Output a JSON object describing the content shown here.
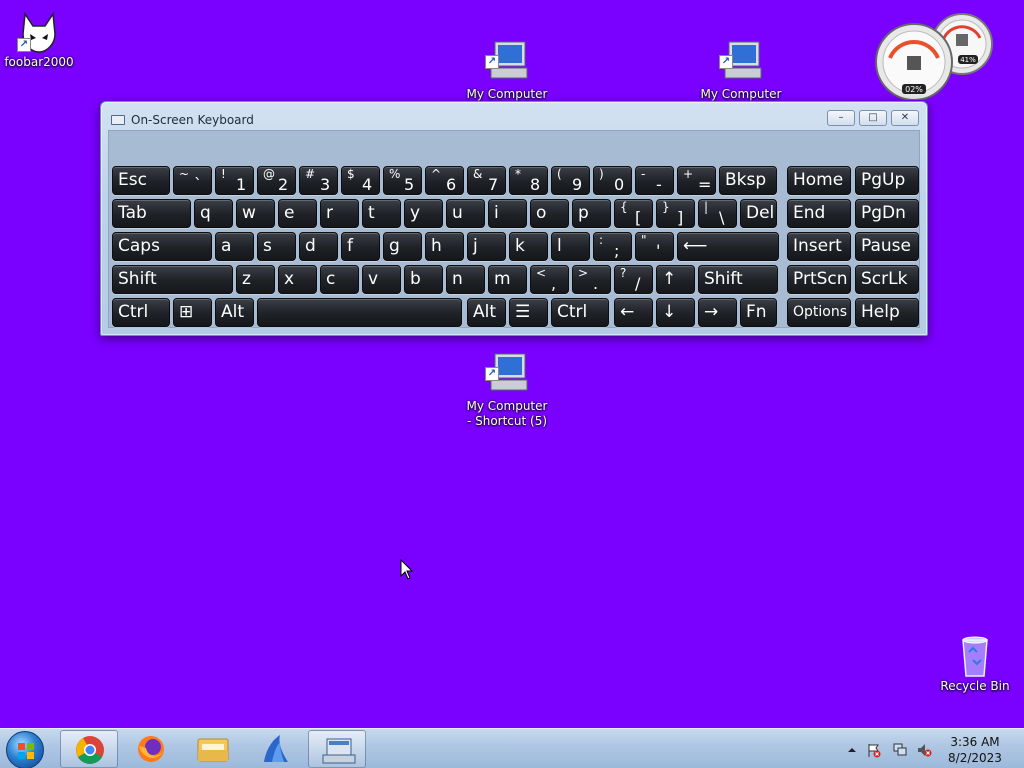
{
  "desktop": {
    "icons": {
      "foobar": {
        "label": "foobar2000"
      },
      "mc4": {
        "label": "My Computer\n- Shortcut (4)"
      },
      "mc2": {
        "label": "My Computer\n- Shortcut (2)"
      },
      "mc5": {
        "label": "My Computer\n- Shortcut (5)"
      },
      "recycle": {
        "label": "Recycle Bin"
      }
    },
    "gadget": {
      "cpu": "02%",
      "mem": "41%"
    }
  },
  "osk": {
    "title": "On-Screen Keyboard",
    "controls": {
      "minimize": "–",
      "restore": "□",
      "close": "✕"
    },
    "rows": [
      [
        {
          "main": "Esc"
        },
        {
          "up": "~",
          "low": "`"
        },
        {
          "up": "!",
          "low": "1"
        },
        {
          "up": "@",
          "low": "2"
        },
        {
          "up": "#",
          "low": "3"
        },
        {
          "up": "$",
          "low": "4"
        },
        {
          "up": "%",
          "low": "5"
        },
        {
          "up": "^",
          "low": "6"
        },
        {
          "up": "&",
          "low": "7"
        },
        {
          "up": "*",
          "low": "8"
        },
        {
          "up": "(",
          "low": "9"
        },
        {
          "up": ")",
          "low": "0"
        },
        {
          "up": "-",
          "low": "-"
        },
        {
          "up": "+",
          "low": "="
        },
        {
          "main": "Bksp"
        },
        {
          "main": "Home"
        },
        {
          "main": "PgUp"
        }
      ],
      [
        {
          "main": "Tab"
        },
        {
          "main": "q"
        },
        {
          "main": "w"
        },
        {
          "main": "e"
        },
        {
          "main": "r"
        },
        {
          "main": "t"
        },
        {
          "main": "y"
        },
        {
          "main": "u"
        },
        {
          "main": "i"
        },
        {
          "main": "o"
        },
        {
          "main": "p"
        },
        {
          "up": "{",
          "low": "["
        },
        {
          "up": "}",
          "low": "]"
        },
        {
          "up": "|",
          "low": "\\"
        },
        {
          "main": "Del"
        },
        {
          "main": "End"
        },
        {
          "main": "PgDn"
        }
      ],
      [
        {
          "main": "Caps"
        },
        {
          "main": "a"
        },
        {
          "main": "s"
        },
        {
          "main": "d"
        },
        {
          "main": "f"
        },
        {
          "main": "g"
        },
        {
          "main": "h"
        },
        {
          "main": "j"
        },
        {
          "main": "k"
        },
        {
          "main": "l"
        },
        {
          "up": ":",
          "low": ";"
        },
        {
          "up": "\"",
          "low": "'"
        },
        {
          "main": "⟵"
        },
        {
          "main": "Insert"
        },
        {
          "main": "Pause"
        }
      ],
      [
        {
          "main": "Shift"
        },
        {
          "main": "z"
        },
        {
          "main": "x"
        },
        {
          "main": "c"
        },
        {
          "main": "v"
        },
        {
          "main": "b"
        },
        {
          "main": "n"
        },
        {
          "main": "m"
        },
        {
          "up": "<",
          "low": ","
        },
        {
          "up": ">",
          "low": "."
        },
        {
          "up": "?",
          "low": "/"
        },
        {
          "main": "↑"
        },
        {
          "main": "Shift"
        },
        {
          "main": "PrtScn"
        },
        {
          "main": "ScrLk"
        }
      ],
      [
        {
          "main": "Ctrl"
        },
        {
          "main": "⊞"
        },
        {
          "main": "Alt"
        },
        {
          "main": ""
        },
        {
          "main": "Alt"
        },
        {
          "main": "☰"
        },
        {
          "main": "Ctrl"
        },
        {
          "main": "←"
        },
        {
          "main": "↓"
        },
        {
          "main": "→"
        },
        {
          "main": "Fn"
        },
        {
          "main": "Options"
        },
        {
          "main": "Help"
        }
      ]
    ]
  },
  "taskbar": {
    "time": "3:36 AM",
    "date": "8/2/2023",
    "apps": [
      "chrome-icon",
      "firefox-icon",
      "file-explorer-icon",
      "app-icon",
      "on-screen-keyboard-icon"
    ]
  }
}
